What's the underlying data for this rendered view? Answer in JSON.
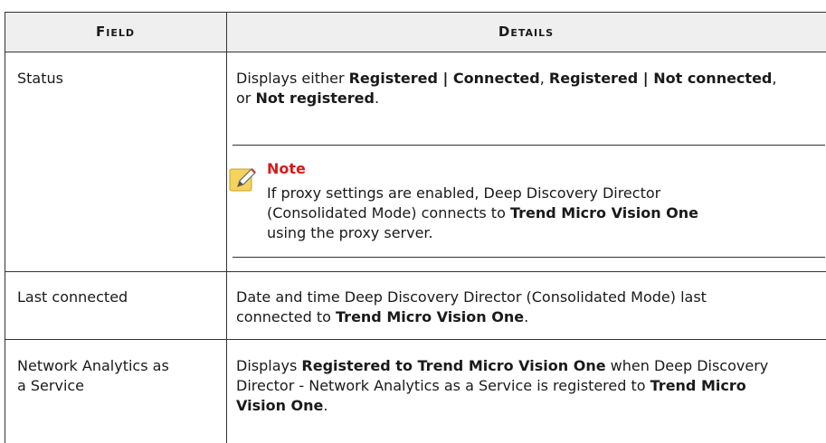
{
  "table": {
    "headers": {
      "field": "Field",
      "details": "Details"
    },
    "rows": [
      {
        "field": "Status",
        "details_parts": [
          "Displays either ",
          "Registered | Connected",
          ", ",
          "Registered | Not connected",
          ",",
          "or ",
          "Not registered",
          "."
        ],
        "note": {
          "title": "Note",
          "line1": "If proxy settings are enabled, Deep Discovery Director",
          "line2": "(Consolidated Mode) connects to ",
          "line2_bold": "Trend Micro Vision One",
          "line3": "using the proxy server."
        }
      },
      {
        "field": "Last connected",
        "line1": "Date and time Deep Discovery Director (Consolidated Mode) last",
        "line2": "connected to ",
        "line2_bold": "Trend Micro Vision One",
        "line2_end": "."
      },
      {
        "field_line1": "Network Analytics as",
        "field_line2": "a Service",
        "line1": "Displays ",
        "line1_bold": "Registered to Trend Micro Vision One",
        "line1_end": " when Deep Discovery",
        "line2": "Director - Network Analytics as a Service is registered to ",
        "line2_bold": "Trend Micro",
        "line3_bold": "Vision One",
        "line3_end": "."
      }
    ]
  }
}
